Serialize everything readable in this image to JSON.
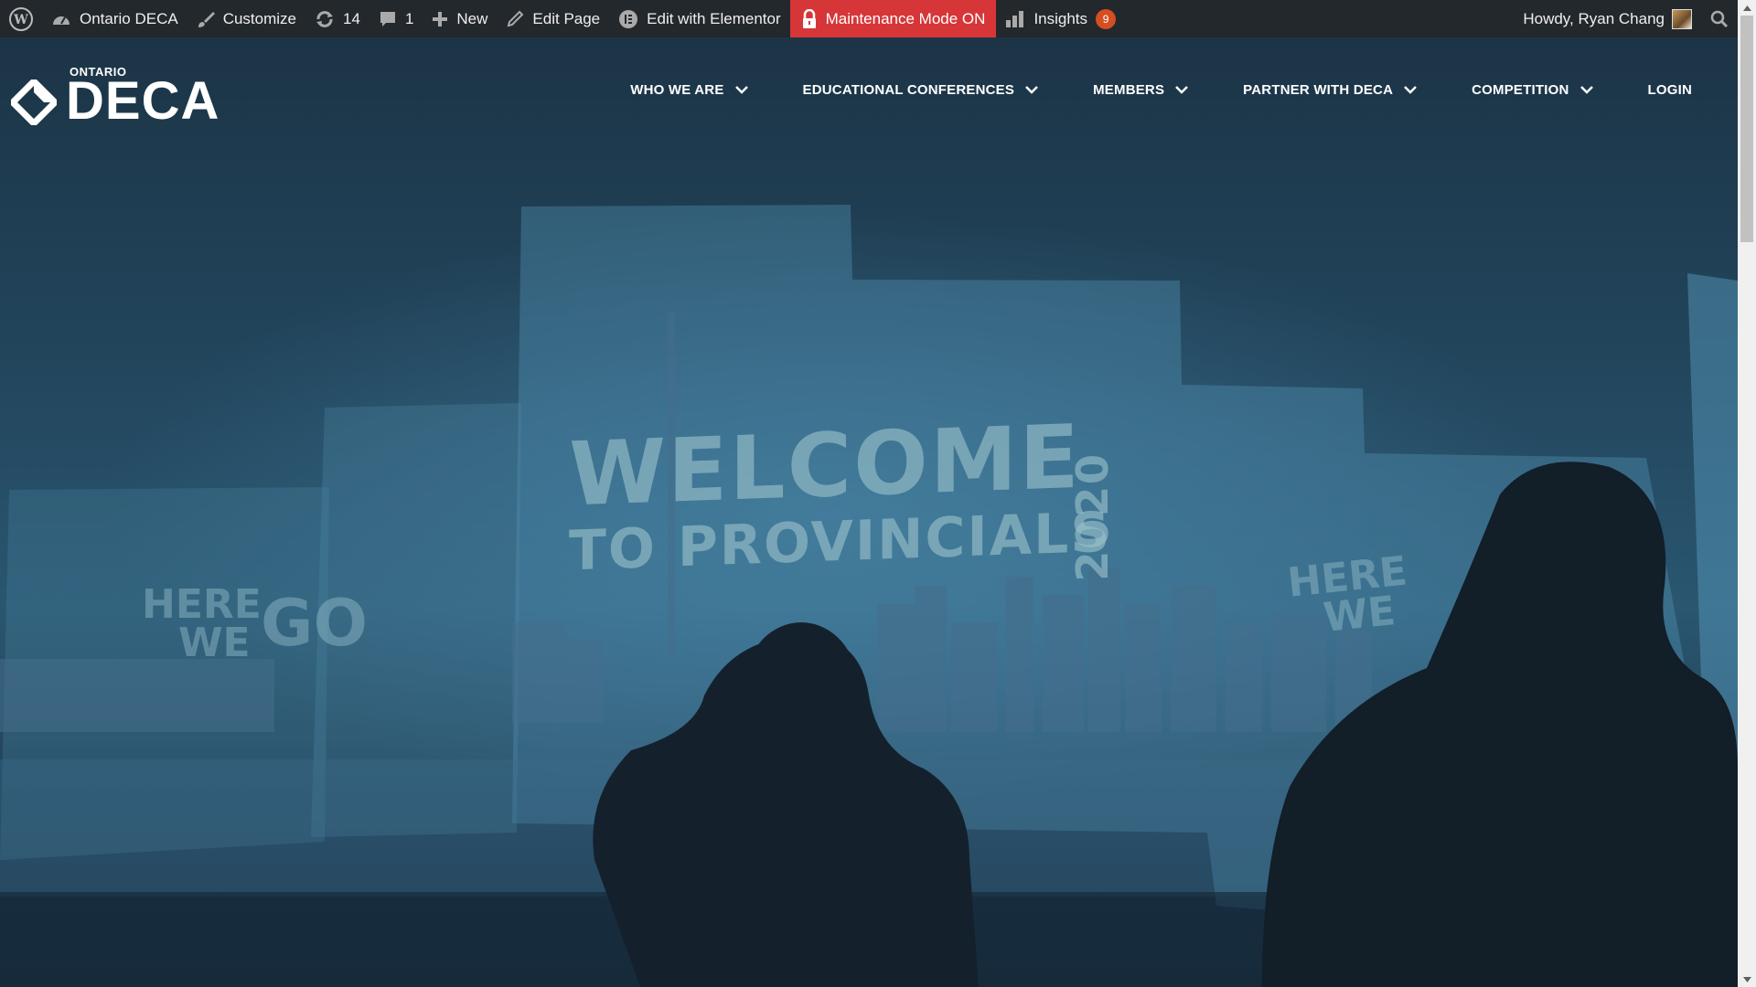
{
  "adminbar": {
    "site_name": "Ontario DECA",
    "customize": "Customize",
    "updates_count": "14",
    "comments_count": "1",
    "new_label": "New",
    "edit_page": "Edit Page",
    "edit_elementor": "Edit with Elementor",
    "maintenance": "Maintenance Mode ON",
    "insights": "Insights",
    "insights_badge": "9",
    "greeting": "Howdy, Ryan Chang"
  },
  "logo": {
    "small": "ONTARIO",
    "big": "DECA"
  },
  "nav": {
    "who_we_are": "WHO WE ARE",
    "conferences": "EDUCATIONAL CONFERENCES",
    "members": "MEMBERS",
    "partner": "PARTNER WITH DECA",
    "competition": "COMPETITION",
    "login": "LOGIN"
  },
  "hero": {
    "line1": "WELCOME",
    "line2": "TO PROVINCIALS",
    "year": "2020",
    "hwg_left_1": "HERE",
    "hwg_left_2": "WE",
    "hwg_left_go": "GO",
    "hwg_right_1": "HERE",
    "hwg_right_2": "WE"
  },
  "colors": {
    "adminbar_bg": "#23282d",
    "maintenance_bg": "#d63638",
    "badge_bg": "#d54e21",
    "hero_tint": "#2a5670"
  }
}
